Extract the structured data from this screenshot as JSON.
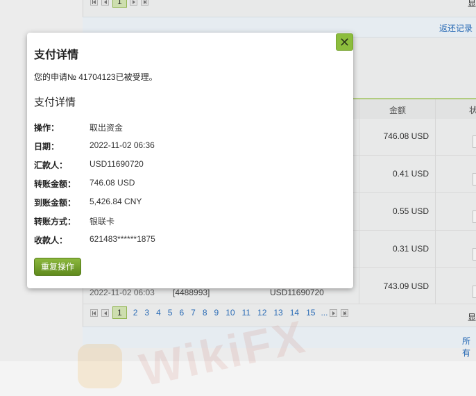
{
  "background": {
    "top_link": "返还记录",
    "bottom_link": "所有",
    "right_edge_char": "显",
    "watermark": "WikiFX",
    "table": {
      "headers": {
        "amount": "金额",
        "status": "状"
      },
      "amounts": [
        "746.08 USD",
        "0.41 USD",
        "0.55 USD",
        "0.31 USD",
        "743.09 USD"
      ],
      "last_row": {
        "date": "2022-11-02 06:03",
        "id": "[4488993]",
        "account": "USD11690720"
      }
    },
    "pager_top": {
      "current": "1"
    },
    "pager_bottom": {
      "pages": [
        "1",
        "2",
        "3",
        "4",
        "5",
        "6",
        "7",
        "8",
        "9",
        "10",
        "11",
        "12",
        "13",
        "14",
        "15"
      ],
      "current": "1",
      "ellipsis": "..."
    }
  },
  "modal": {
    "title": "支付详情",
    "message": "您的申请№ 41704123已被受理。",
    "section_title": "支付详情",
    "close_symbol": "✕",
    "details": [
      {
        "label": "操作：",
        "value": "取出资金"
      },
      {
        "label": "日期：",
        "value": "2022-11-02 06:36"
      },
      {
        "label": "汇款人：",
        "value": "USD11690720"
      },
      {
        "label": "转账金额：",
        "value": "746.08 USD"
      },
      {
        "label": "到账金额：",
        "value": "5,426.84 CNY"
      },
      {
        "label": "转账方式：",
        "value": "银联卡"
      },
      {
        "label": "收款人：",
        "value": "621483******1875"
      }
    ],
    "repeat_button": "重复操作"
  },
  "colors": {
    "accent_green": "#8cbd3d",
    "link_blue": "#2a6ebb"
  },
  "icons": {
    "close": "close-icon",
    "pager_first": "first-page-icon",
    "pager_prev": "prev-page-icon",
    "pager_next": "next-page-icon",
    "pager_last": "last-page-icon"
  }
}
